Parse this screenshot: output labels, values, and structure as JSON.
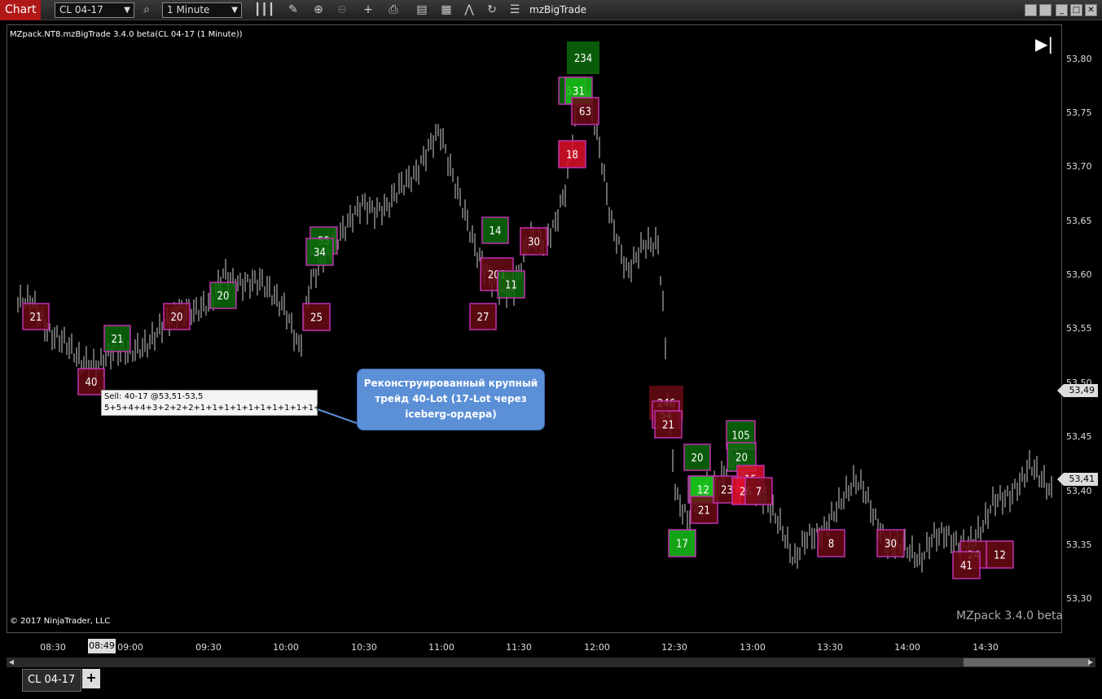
{
  "toolbar": {
    "chart_tab": "Chart",
    "instrument": "CL 04-17",
    "interval": "1 Minute",
    "indicator_title": "mzBigTrade",
    "icons": [
      "search-icon",
      "bar-type-icon",
      "pencil-icon",
      "zoom-in-icon",
      "zoom-out-icon",
      "crosshair-icon",
      "data-box-icon",
      "strategies-icon",
      "templates-icon",
      "indicators-icon",
      "refresh-icon",
      "properties-icon"
    ]
  },
  "chart": {
    "label": "MZpack.NT8.mzBigTrade 3.4.0 beta(CL 04-17 (1 Minute))",
    "copyright": "© 2017 NinjaTrader, LLC",
    "watermark": "MZpack 3.4.0 beta",
    "goto_end": "▶|"
  },
  "y_axis": {
    "ticks": [
      "53,80",
      "53,75",
      "53,70",
      "53,65",
      "53,60",
      "53,55",
      "53,50",
      "53,45",
      "53,40",
      "53,35",
      "53,30"
    ],
    "price_tags": [
      "53,49",
      "53,41"
    ]
  },
  "x_axis": {
    "ticks": [
      "08:30",
      "09:00",
      "09:30",
      "10:00",
      "10:30",
      "11:00",
      "11:30",
      "12:00",
      "12:30",
      "13:00",
      "13:30",
      "14:00",
      "14:30"
    ],
    "cursor_label": "08:49"
  },
  "tooltip": {
    "line1": "Sell:  40-17  @53,51-53,5",
    "line2": "5+5+4+4+3+2+2+2+1+1+1+1+1+1+1+1+1+1+1+1..."
  },
  "callout": {
    "text": "Реконструированный крупный трейд 40-Lot (17-Lot через iceberg-ордера)"
  },
  "trades": [
    {
      "label": "21",
      "side": "sell"
    },
    {
      "label": "40",
      "side": "sell"
    },
    {
      "label": "21",
      "side": "buy"
    },
    {
      "label": "20",
      "side": "sell"
    },
    {
      "label": "20",
      "side": "buy"
    },
    {
      "label": "55",
      "side": "buy"
    },
    {
      "label": "34",
      "side": "buy"
    },
    {
      "label": "25",
      "side": "sell"
    },
    {
      "label": "14",
      "side": "buy"
    },
    {
      "label": "201",
      "side": "sell"
    },
    {
      "label": "11",
      "side": "buy"
    },
    {
      "label": "27",
      "side": "sell"
    },
    {
      "label": "30",
      "side": "sell"
    },
    {
      "label": "234",
      "side": "buy"
    },
    {
      "label": "53",
      "side": "buy"
    },
    {
      "label": "31",
      "side": "buy"
    },
    {
      "label": "63",
      "side": "sell"
    },
    {
      "label": "18",
      "side": "sell"
    },
    {
      "label": "246",
      "side": "sell"
    },
    {
      "label": "54",
      "side": "sell"
    },
    {
      "label": "21",
      "side": "sell"
    },
    {
      "label": "105",
      "side": "buy"
    },
    {
      "label": "20",
      "side": "buy"
    },
    {
      "label": "20",
      "side": "buy"
    },
    {
      "label": "16",
      "side": "buy"
    },
    {
      "label": "12",
      "side": "buy"
    },
    {
      "label": "21",
      "side": "sell"
    },
    {
      "label": "23",
      "side": "sell"
    },
    {
      "label": "15",
      "side": "sell"
    },
    {
      "label": "26",
      "side": "sell"
    },
    {
      "label": "7",
      "side": "sell"
    },
    {
      "label": "17",
      "side": "buy"
    },
    {
      "label": "8",
      "side": "sell"
    },
    {
      "label": "30",
      "side": "sell"
    },
    {
      "label": "24",
      "side": "sell"
    },
    {
      "label": "41",
      "side": "sell"
    },
    {
      "label": "12",
      "side": "sell"
    }
  ],
  "bottom": {
    "instrument_tab": "CL 04-17",
    "add_tab": "+"
  },
  "colors": {
    "buy_fill": "#0b6b0b",
    "buy_bright": "#18c018",
    "sell_fill": "#6a0b14",
    "sell_bright": "#e0102a",
    "box_border": "#c030b0",
    "bars": "#cfcfcf"
  }
}
